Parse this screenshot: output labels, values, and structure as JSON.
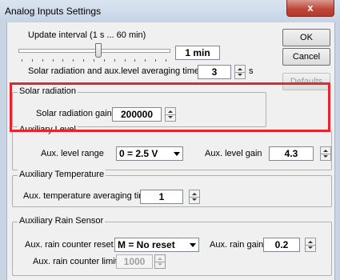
{
  "window": {
    "title": "Analog Inputs Settings",
    "close_label": "x"
  },
  "update": {
    "interval_label": "Update interval (1 s ... 60 min)",
    "interval_value": "1 min",
    "slider_fraction": 0.53,
    "averaging_label": "Solar radiation and aux.level averaging time",
    "averaging_value": "3",
    "averaging_unit": "s"
  },
  "buttons": {
    "ok": "OK",
    "cancel": "Cancel",
    "defaults": "Defaults"
  },
  "solar": {
    "group_label": "Solar radiation",
    "gain_label": "Solar radiation gain",
    "gain_value": "200000"
  },
  "aux_level": {
    "group_label": "Auxiliary Level",
    "range_label": "Aux. level range",
    "range_value": "0 = 2.5 V",
    "gain_label": "Aux. level gain",
    "gain_value": "4.3"
  },
  "aux_temp": {
    "group_label": "Auxiliary Temperature",
    "averaging_label": "Aux. temperature averaging time",
    "averaging_value": "1"
  },
  "aux_rain": {
    "group_label": "Auxiliary Rain Sensor",
    "reset_label": "Aux. rain counter reset",
    "reset_value": "M = No reset",
    "gain_label": "Aux. rain gain",
    "gain_value": "0.2",
    "limit_label": "Aux. rain counter limit",
    "limit_value": "1000"
  },
  "colors": {
    "highlight": "#e4262e",
    "close_button": "#c0473a"
  }
}
